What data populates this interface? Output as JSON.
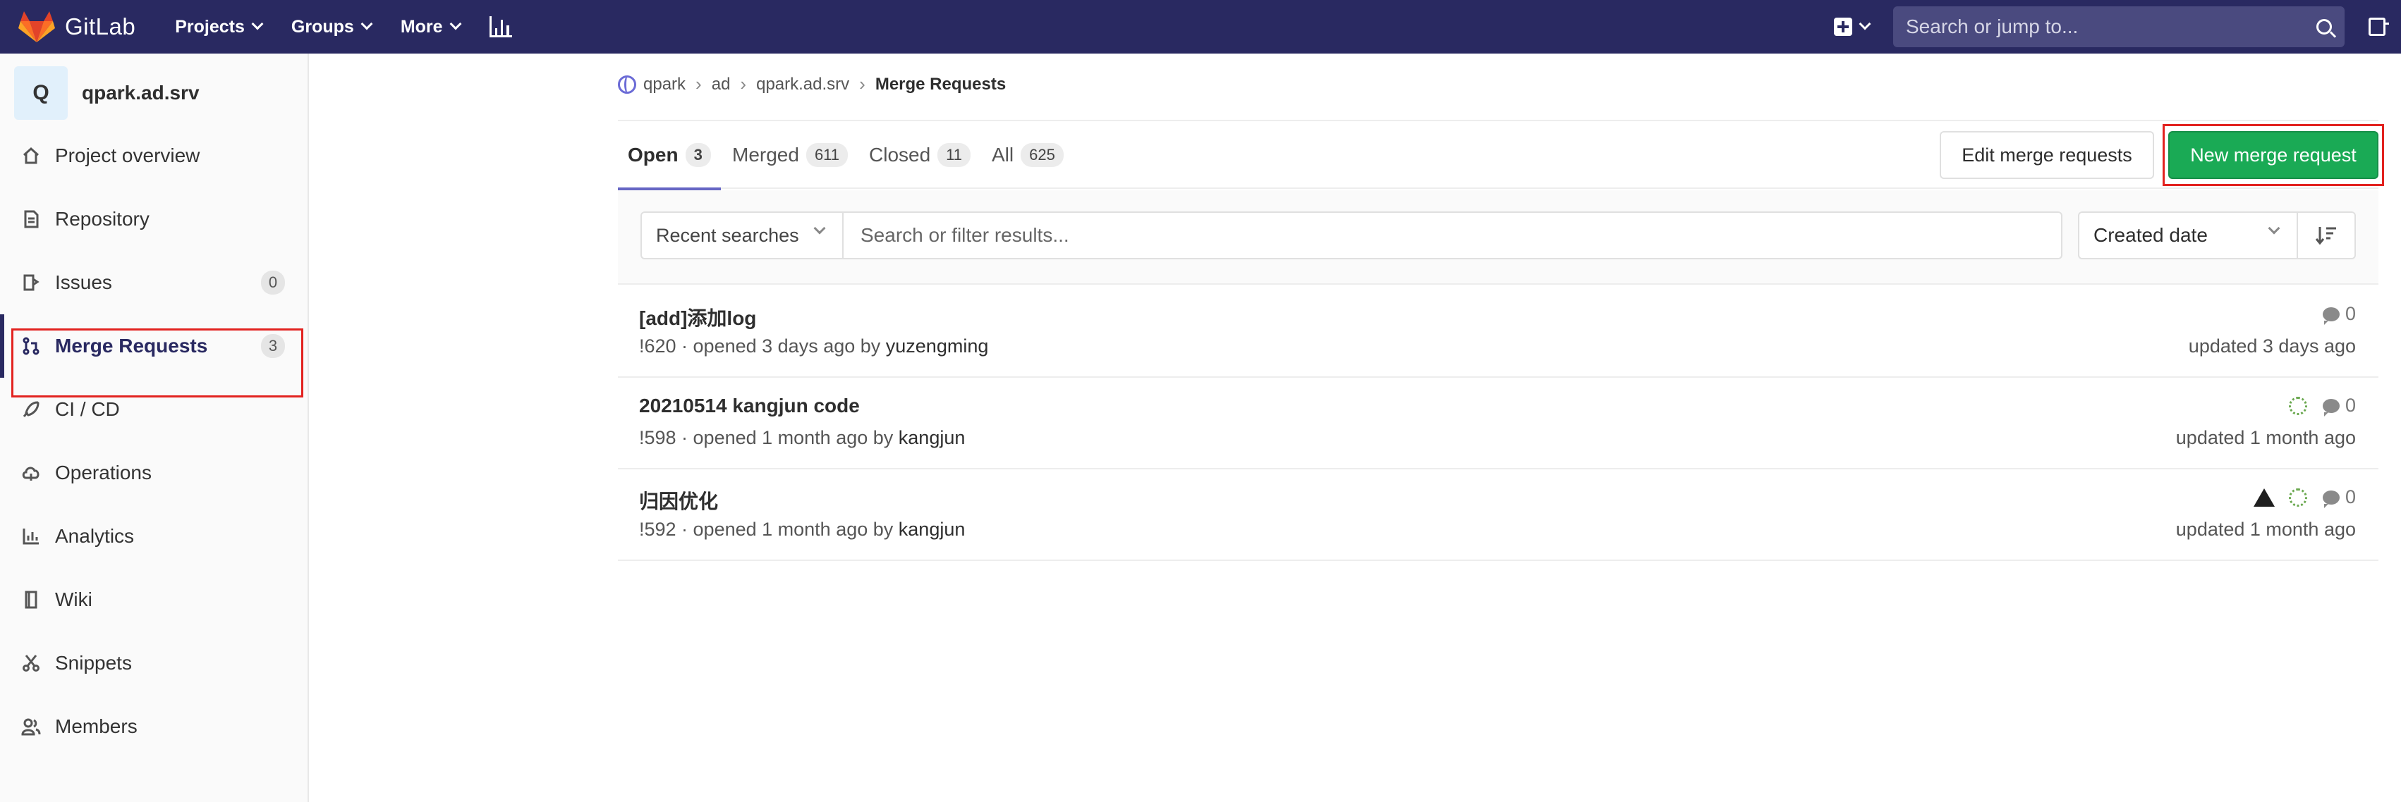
{
  "app": {
    "brand": "GitLab"
  },
  "nav": {
    "projects": "Projects",
    "groups": "Groups",
    "more": "More",
    "search_placeholder": "Search or jump to..."
  },
  "sidebar": {
    "avatar_letter": "Q",
    "project_name": "qpark.ad.srv",
    "items": [
      {
        "label": "Project overview",
        "icon": "home-icon"
      },
      {
        "label": "Repository",
        "icon": "doc-icon"
      },
      {
        "label": "Issues",
        "icon": "issues-icon",
        "badge": "0"
      },
      {
        "label": "Merge Requests",
        "icon": "merge-icon",
        "badge": "3"
      },
      {
        "label": "CI / CD",
        "icon": "rocket-icon"
      },
      {
        "label": "Operations",
        "icon": "cloud-icon"
      },
      {
        "label": "Analytics",
        "icon": "chart-icon"
      },
      {
        "label": "Wiki",
        "icon": "book-icon"
      },
      {
        "label": "Snippets",
        "icon": "scissors-icon"
      },
      {
        "label": "Members",
        "icon": "users-icon"
      }
    ]
  },
  "breadcrumb": [
    "qpark",
    "ad",
    "qpark.ad.srv",
    "Merge Requests"
  ],
  "tabs": [
    {
      "label": "Open",
      "count": "3"
    },
    {
      "label": "Merged",
      "count": "611"
    },
    {
      "label": "Closed",
      "count": "11"
    },
    {
      "label": "All",
      "count": "625"
    }
  ],
  "buttons": {
    "edit": "Edit merge requests",
    "new": "New merge request"
  },
  "filter": {
    "recent": "Recent searches",
    "placeholder": "Search or filter results...",
    "sort": "Created date"
  },
  "merge_requests": [
    {
      "title": "[add]添加log",
      "meta": "!620 · opened 3 days ago by ",
      "author": "yuzengming",
      "comments": "0",
      "updated": "updated 3 days ago",
      "pipeline": false,
      "warning": false
    },
    {
      "title": "20210514 kangjun code",
      "meta": "!598 · opened 1 month ago by ",
      "author": "kangjun",
      "comments": "0",
      "updated": "updated 1 month ago",
      "pipeline": true,
      "warning": false
    },
    {
      "title": "归因优化",
      "meta": "!592 · opened 1 month ago by ",
      "author": "kangjun",
      "comments": "0",
      "updated": "updated 1 month ago",
      "pipeline": true,
      "warning": true
    }
  ],
  "colors": {
    "navbar": "#292961",
    "accent": "#6666c4",
    "success": "#1aaa55",
    "highlight": "#e2221f"
  }
}
